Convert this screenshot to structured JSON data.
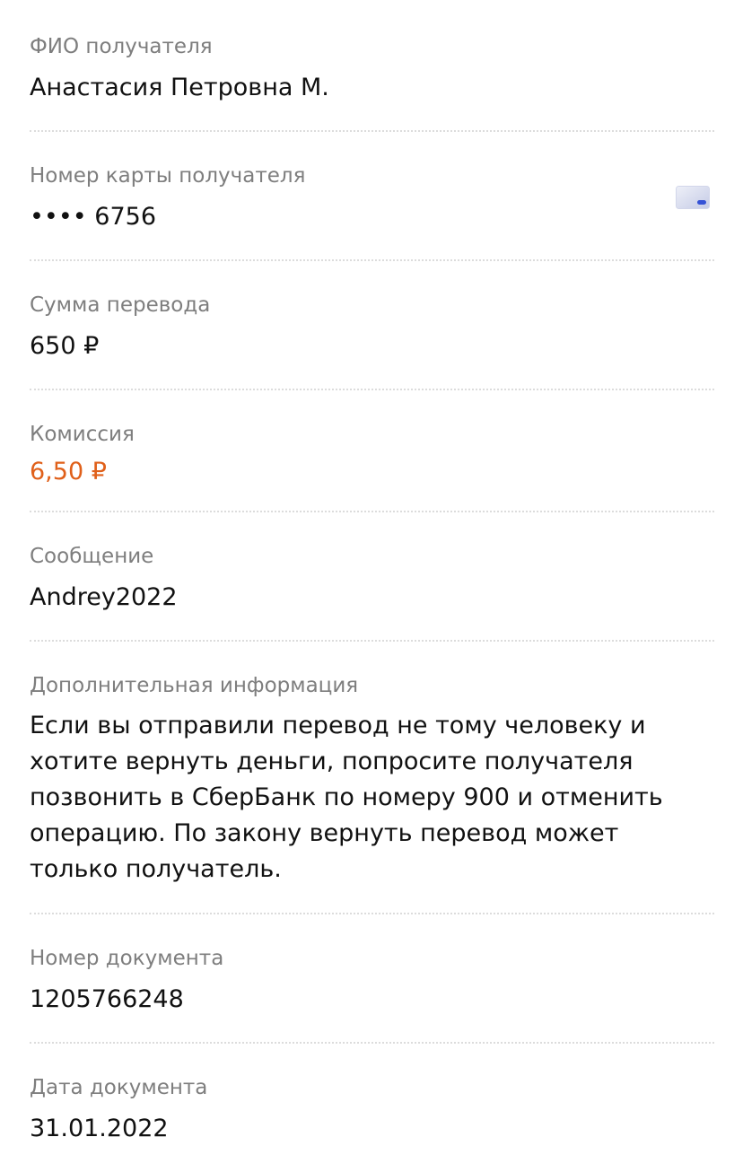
{
  "fields": [
    {
      "label": "ФИО получателя",
      "value": "Анастасия Петровна М."
    },
    {
      "label": "Номер карты получателя",
      "value": "•••• 6756",
      "icon": "bank-card-icon"
    },
    {
      "label": "Сумма перевода",
      "value": "650 ₽"
    },
    {
      "label": "Комиссия",
      "value": "6,50 ₽",
      "value_color": "#e0601a"
    },
    {
      "label": "Сообщение",
      "value": "Andrey2022"
    },
    {
      "label": "Дополнительная информация",
      "value": "Если вы отправили перевод не тому человеку и хотите вернуть деньги, попросите получателя позвонить в СберБанк по номеру 900 и отменить операцию. По закону вернуть перевод может только получатель."
    },
    {
      "label": "Номер документа",
      "value": "1205766248"
    },
    {
      "label": "Дата документа",
      "value": "31.01.2022"
    }
  ],
  "colors": {
    "label": "#7e7e7e",
    "value": "#111111",
    "accent": "#e0601a",
    "divider": "#dcdcdc"
  }
}
